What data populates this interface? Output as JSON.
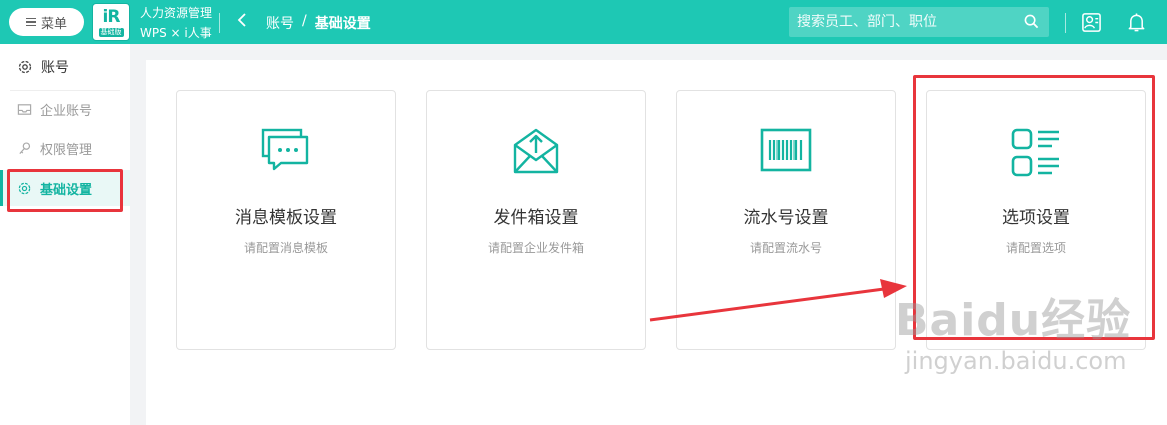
{
  "header": {
    "menu_label": "菜单",
    "logo_mark": "iR",
    "logo_sub": "基础版",
    "product_line1": "人力资源管理",
    "product_line2": "WPS × i人事",
    "breadcrumb": [
      "账号",
      "/",
      "基础设置"
    ],
    "search_placeholder": "搜索员工、部门、职位",
    "accent_color": "#1ec8b4"
  },
  "sidebar": {
    "title": "账号",
    "items": [
      {
        "label": "企业账号",
        "icon": "inbox-icon"
      },
      {
        "label": "权限管理",
        "icon": "key-icon"
      },
      {
        "label": "基础设置",
        "icon": "gear-icon",
        "active": true
      }
    ]
  },
  "cards": [
    {
      "title": "消息模板设置",
      "desc": "请配置消息模板",
      "icon": "message-icon"
    },
    {
      "title": "发件箱设置",
      "desc": "请配置企业发件箱",
      "icon": "mail-send-icon"
    },
    {
      "title": "流水号设置",
      "desc": "请配置流水号",
      "icon": "barcode-icon"
    },
    {
      "title": "选项设置",
      "desc": "请配置选项",
      "icon": "option-list-icon"
    }
  ],
  "watermark": {
    "line1": "Baidu经验",
    "line2": "jingyan.baidu.com"
  },
  "annotation_color": "#e8353c"
}
